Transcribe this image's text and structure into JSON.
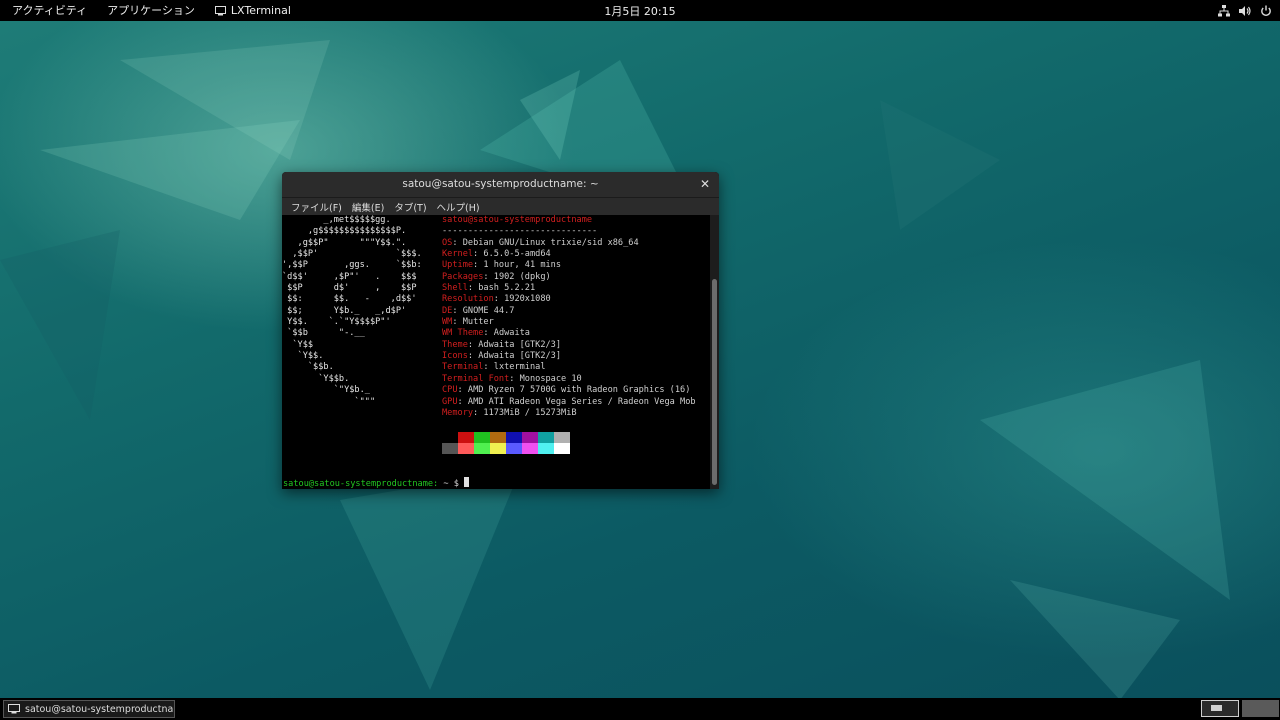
{
  "topbar": {
    "activities": "アクティビティ",
    "applications": "アプリケーション",
    "app_name": "LXTerminal",
    "clock": "1月5日  20:15",
    "status_icons": [
      "network-icon",
      "volume-icon",
      "power-icon"
    ]
  },
  "terminal": {
    "title": "satou@satou-systemproductname: ~",
    "menu": [
      "ファイル(F)",
      "編集(E)",
      "タブ(T)",
      "ヘルプ(H)"
    ],
    "ascii_logo": "        _,met$$$$$gg.\n     ,g$$$$$$$$$$$$$$$P.\n   ,g$$P\"      \"\"\"Y$$.\".\n  ,$$P'               `$$$.\n',$$P       ,ggs.     `$$b:\n`d$$'     ,$P\"'   .    $$$\n $$P      d$'     ,    $$P\n $$:      $$.   -    ,d$$'\n $$;      Y$b._   _,d$P'\n Y$$.    `.`\"Y$$$$P\"'\n `$$b      \"-.__\n  `Y$$\n   `Y$$.\n     `$$b.\n       `Y$$b.\n          `\"Y$b._\n              `\"\"\"",
    "userhost": "satou@satou-systemproductname",
    "separator": "------------------------------",
    "info": [
      {
        "key": "OS",
        "value": "Debian GNU/Linux trixie/sid x86_64"
      },
      {
        "key": "Kernel",
        "value": "6.5.0-5-amd64"
      },
      {
        "key": "Uptime",
        "value": "1 hour, 41 mins"
      },
      {
        "key": "Packages",
        "value": "1902 (dpkg)"
      },
      {
        "key": "Shell",
        "value": "bash 5.2.21"
      },
      {
        "key": "Resolution",
        "value": "1920x1080"
      },
      {
        "key": "DE",
        "value": "GNOME 44.7"
      },
      {
        "key": "WM",
        "value": "Mutter"
      },
      {
        "key": "WM Theme",
        "value": "Adwaita"
      },
      {
        "key": "Theme",
        "value": "Adwaita [GTK2/3]"
      },
      {
        "key": "Icons",
        "value": "Adwaita [GTK2/3]"
      },
      {
        "key": "Terminal",
        "value": "lxterminal"
      },
      {
        "key": "Terminal Font",
        "value": "Monospace 10"
      },
      {
        "key": "CPU",
        "value": "AMD Ryzen 7 5700G with Radeon Graphics (16)"
      },
      {
        "key": "GPU",
        "value": "AMD ATI Radeon Vega Series / Radeon Vega Mob"
      },
      {
        "key": "Memory",
        "value": "1173MiB / 15273MiB"
      }
    ],
    "palette_dark": [
      "#000000",
      "#cc1010",
      "#20c020",
      "#b06a10",
      "#1010b0",
      "#a010a0",
      "#10a0a0",
      "#b0b0b0"
    ],
    "palette_bright": [
      "#555555",
      "#ff5a5a",
      "#50f050",
      "#f0f050",
      "#5a5aff",
      "#f050f0",
      "#50f0f0",
      "#ffffff"
    ],
    "prompt_user": "satou@satou-systemproductname:",
    "prompt_path": " ~ ",
    "prompt_symbol": "$ "
  },
  "taskbar": {
    "window_label": "satou@satou-systemproductnam..."
  }
}
